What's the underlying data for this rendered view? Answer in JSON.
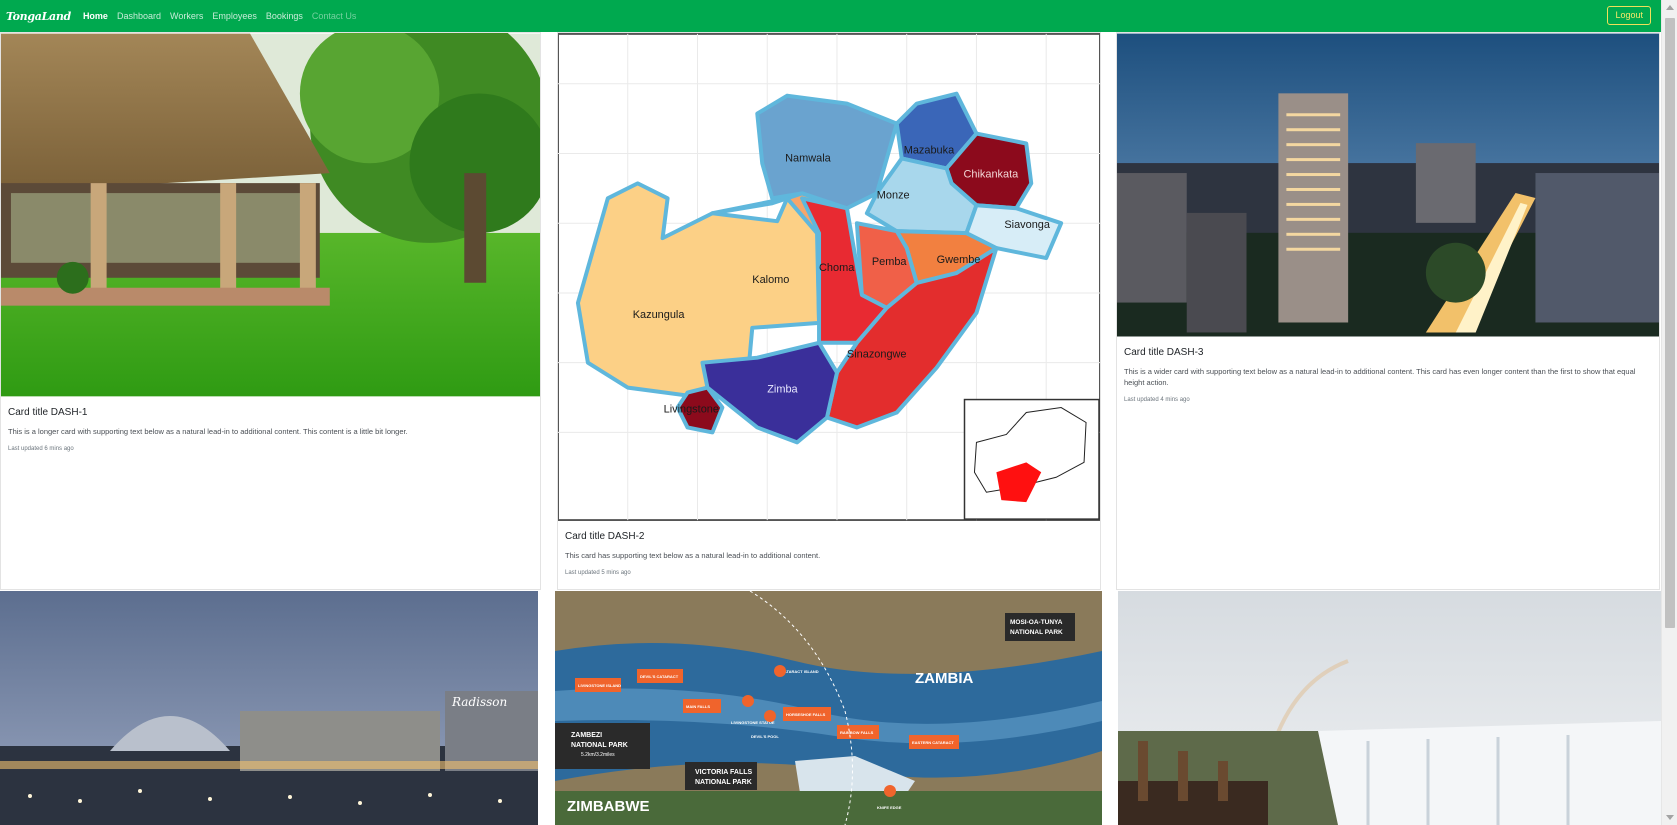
{
  "navbar": {
    "brand": "TongaLand",
    "links": [
      "Home",
      "Dashboard",
      "Workers",
      "Employees",
      "Bookings",
      "Contact Us"
    ],
    "logout_label": "Logout"
  },
  "cards": [
    {
      "title": "Card title DASH-1",
      "text": "This is a longer card with supporting text below as a natural lead-in to additional content. This content is a little bit longer.",
      "updated": "Last updated 6 mins ago"
    },
    {
      "title": "Card title DASH-2",
      "text": "This card has supporting text below as a natural lead-in to additional content.",
      "updated": "Last updated 5 mins ago",
      "map_labels": [
        "Namwala",
        "Mazabuka",
        "Chikankata",
        "Monze",
        "Siavonga",
        "Kalomo",
        "Choma",
        "Pemba",
        "Gwembe",
        "Kazungula",
        "Sinazongwe",
        "Zimba",
        "Livingstone"
      ]
    },
    {
      "title": "Card title DASH-3",
      "text": "This is a wider card with supporting text below as a natural lead-in to additional content. This card has even longer content than the first to show that equal height action.",
      "updated": "Last updated 4 mins ago"
    }
  ],
  "falls_map": {
    "country_north": "ZAMBIA",
    "country_south": "ZIMBABWE",
    "park_north_line1": "MOSI-OA-TUNYA",
    "park_north_line2": "NATIONAL PARK",
    "zambezi_line1": "ZAMBEZI",
    "zambezi_line2": "NATIONAL PARK",
    "zambezi_distance": "5.2km/3.2miles",
    "vf_line1": "VICTORIA FALLS",
    "vf_line2": "NATIONAL PARK",
    "tags": [
      "LIVINGSTONE ISLAND",
      "DEVIL'S CATARACT",
      "MAIN FALLS",
      "HORSESHOE FALLS",
      "RAINBOW FALLS",
      "EASTERN CATARACT",
      "CATARACT ISLAND",
      "LIVINGSTONE STATUE",
      "DEVIL'S POOL",
      "KNIFE EDGE"
    ]
  },
  "hotel_sign": "Radisson",
  "colors": {
    "navbar": "#00a94f",
    "logout": "#f1e05a"
  }
}
